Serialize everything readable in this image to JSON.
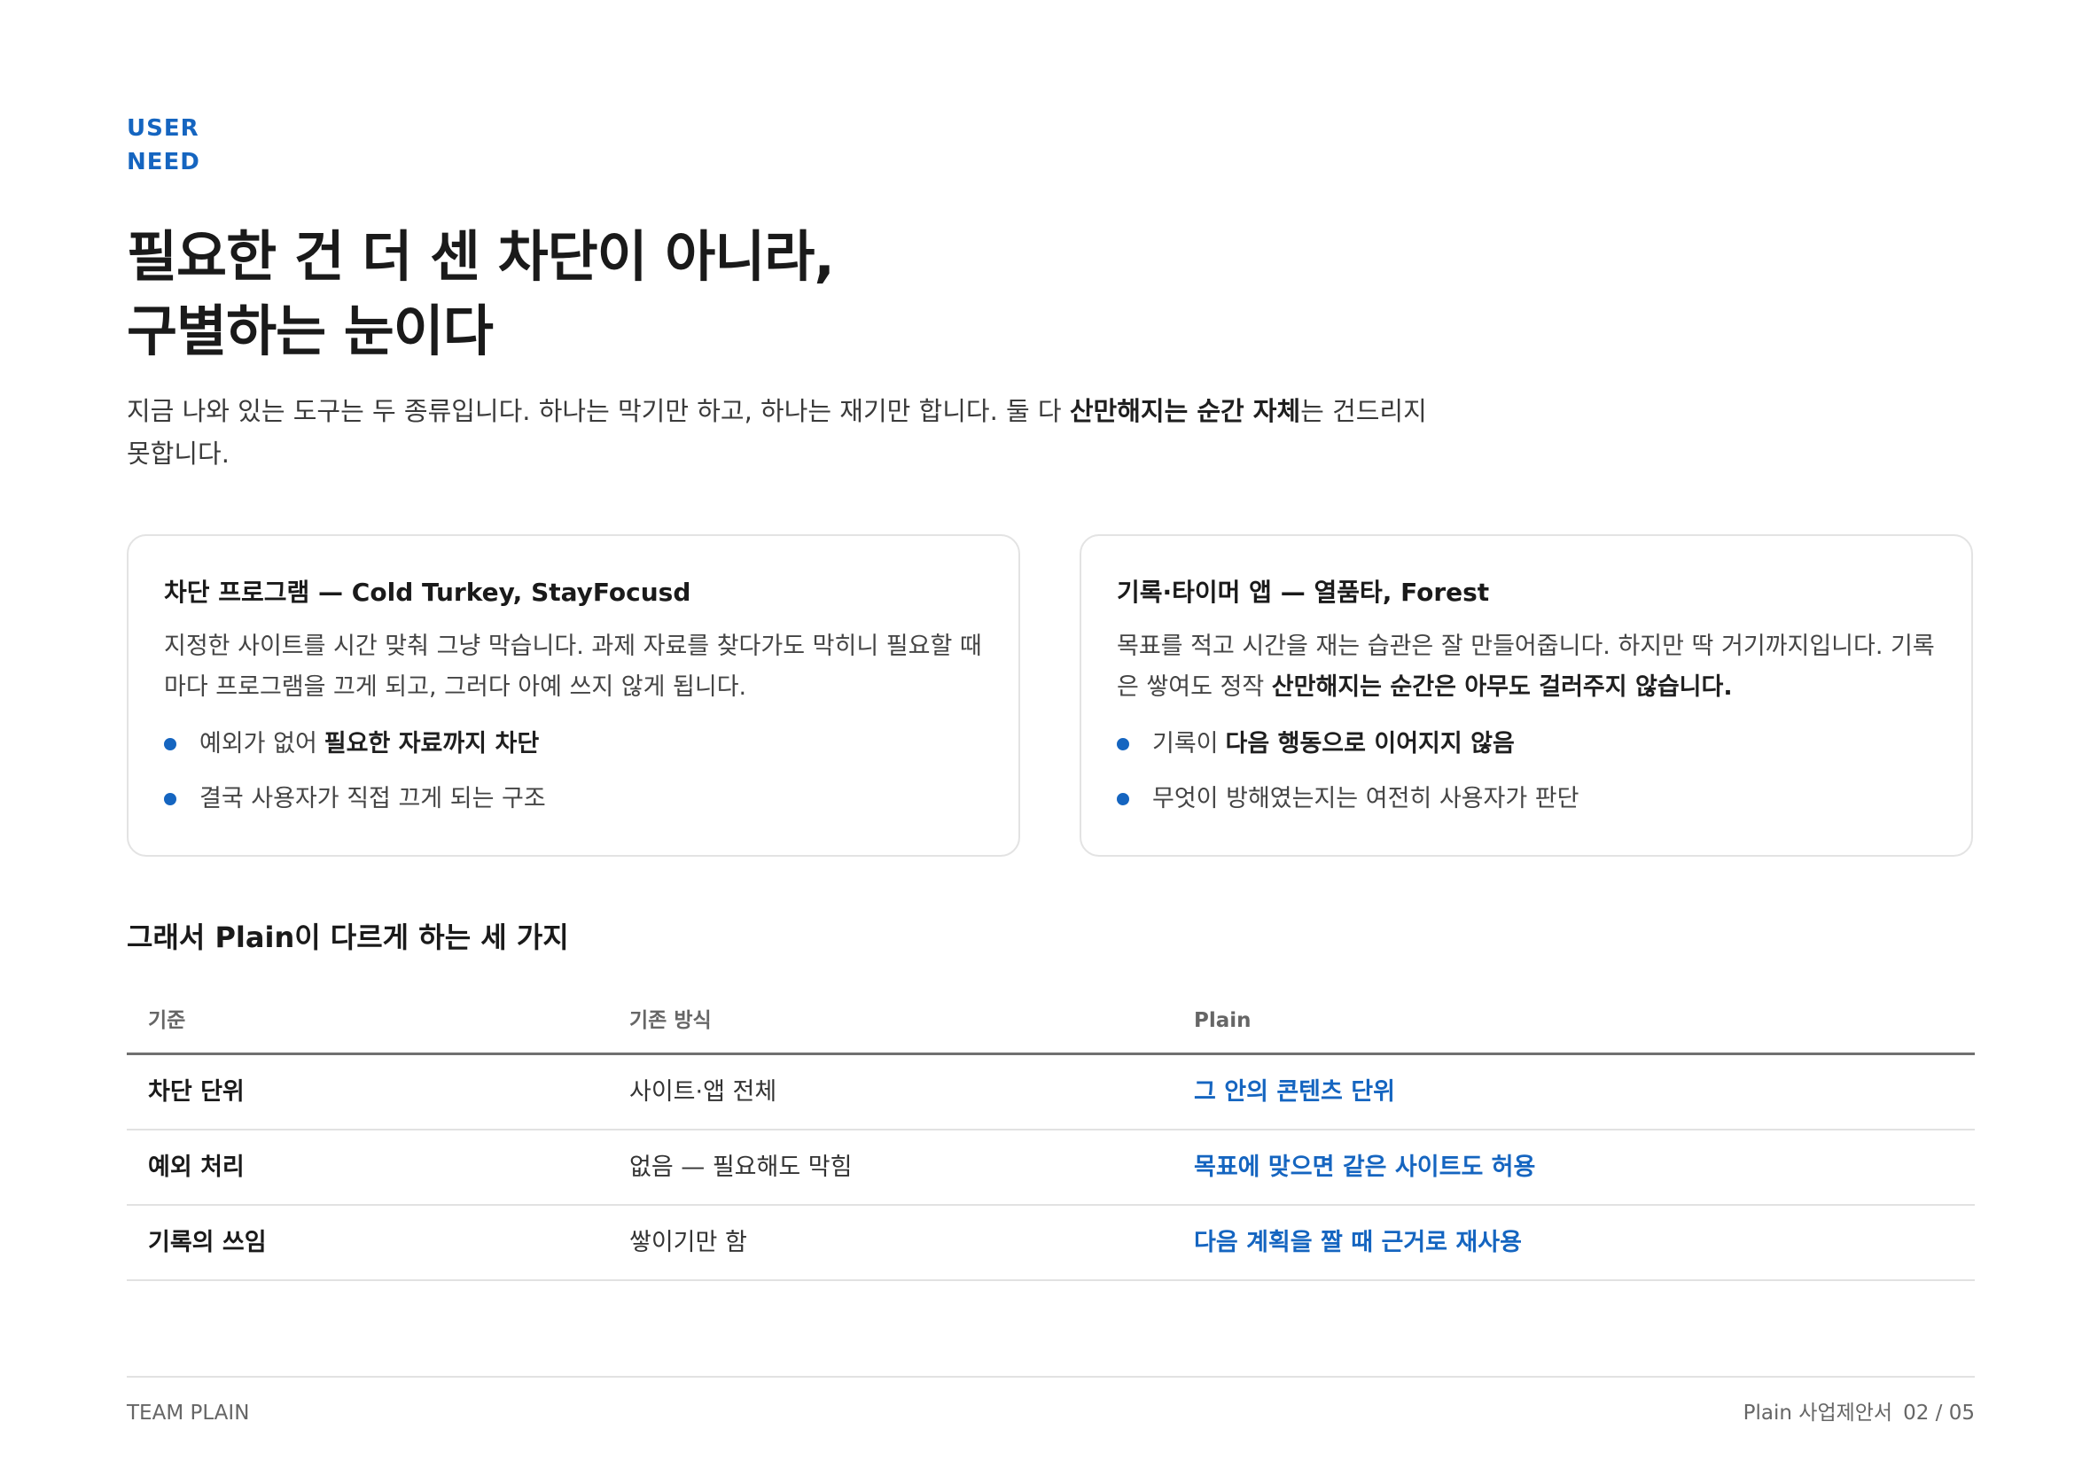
{
  "eyebrow": {
    "line1": "USER",
    "line2": "NEED"
  },
  "headline": {
    "line1": "필요한 건 더 센 차단이 아니라,",
    "line2": "구별하는 눈이다"
  },
  "intro": {
    "before": "지금 나와 있는 도구는 두 종류입니다. 하나는 막기만 하고, 하나는 재기만 합니다. 둘 다 ",
    "bold": "산만해지는 순간 자체",
    "after": "는 건드리지 못합니다."
  },
  "cards": [
    {
      "title": "차단 프로그램 — Cold Turkey, StayFocusd",
      "desc": "지정한 사이트를 시간 맞춰 그냥 막습니다. 과제 자료를 찾다가도 막히니 필요할 때마다 프로그램을 끄게 되고, 그러다 아예 쓰지 않게 됩니다.",
      "bullets": [
        {
          "text": "예외가 없어",
          "bold": "필요한 자료까지 차단"
        },
        {
          "text": "결국 사용자가 직접 끄게 되는 구조",
          "bold": ""
        }
      ]
    },
    {
      "title": "기록·타이머 앱 — 열품타, Forest",
      "desc": "목표를 적고 시간을 재는 습관은 잘 만들어줍니다. 하지만 딱 거기까지입니다. 기록은 쌓여도 정작 ",
      "desc_bold": "산만해지는 순간은 아무도 걸러주지 않습니다.",
      "bullets": [
        {
          "text": "기록이",
          "bold": "다음 행동으로 이어지지 않음"
        },
        {
          "text": "무엇이 방해였는지는 여전히 사용자가 판단",
          "bold": ""
        }
      ]
    }
  ],
  "section_title": "그래서 Plain이 다르게 하는 세 가지",
  "table": {
    "headers": [
      "기준",
      "기존 방식",
      "Plain"
    ],
    "rows": [
      [
        "차단 단위",
        "사이트·앱 전체",
        "그 안의 콘텐츠 단위"
      ],
      [
        "예외 처리",
        "없음 — 필요해도 막힘",
        "목표에 맞으면 같은 사이트도 허용"
      ],
      [
        "기록의 쓰임",
        "쌓이기만 함",
        "다음 계획을 짤 때 근거로 재사용"
      ]
    ]
  },
  "footer": {
    "left": "TEAM PLAIN",
    "doc_title": "Plain 사업제안서",
    "page": "02 / 05"
  },
  "colors": {
    "accent": "#1565c0",
    "text": "#1f1f1f",
    "muted": "#666666",
    "border": "#e3e3e3"
  }
}
